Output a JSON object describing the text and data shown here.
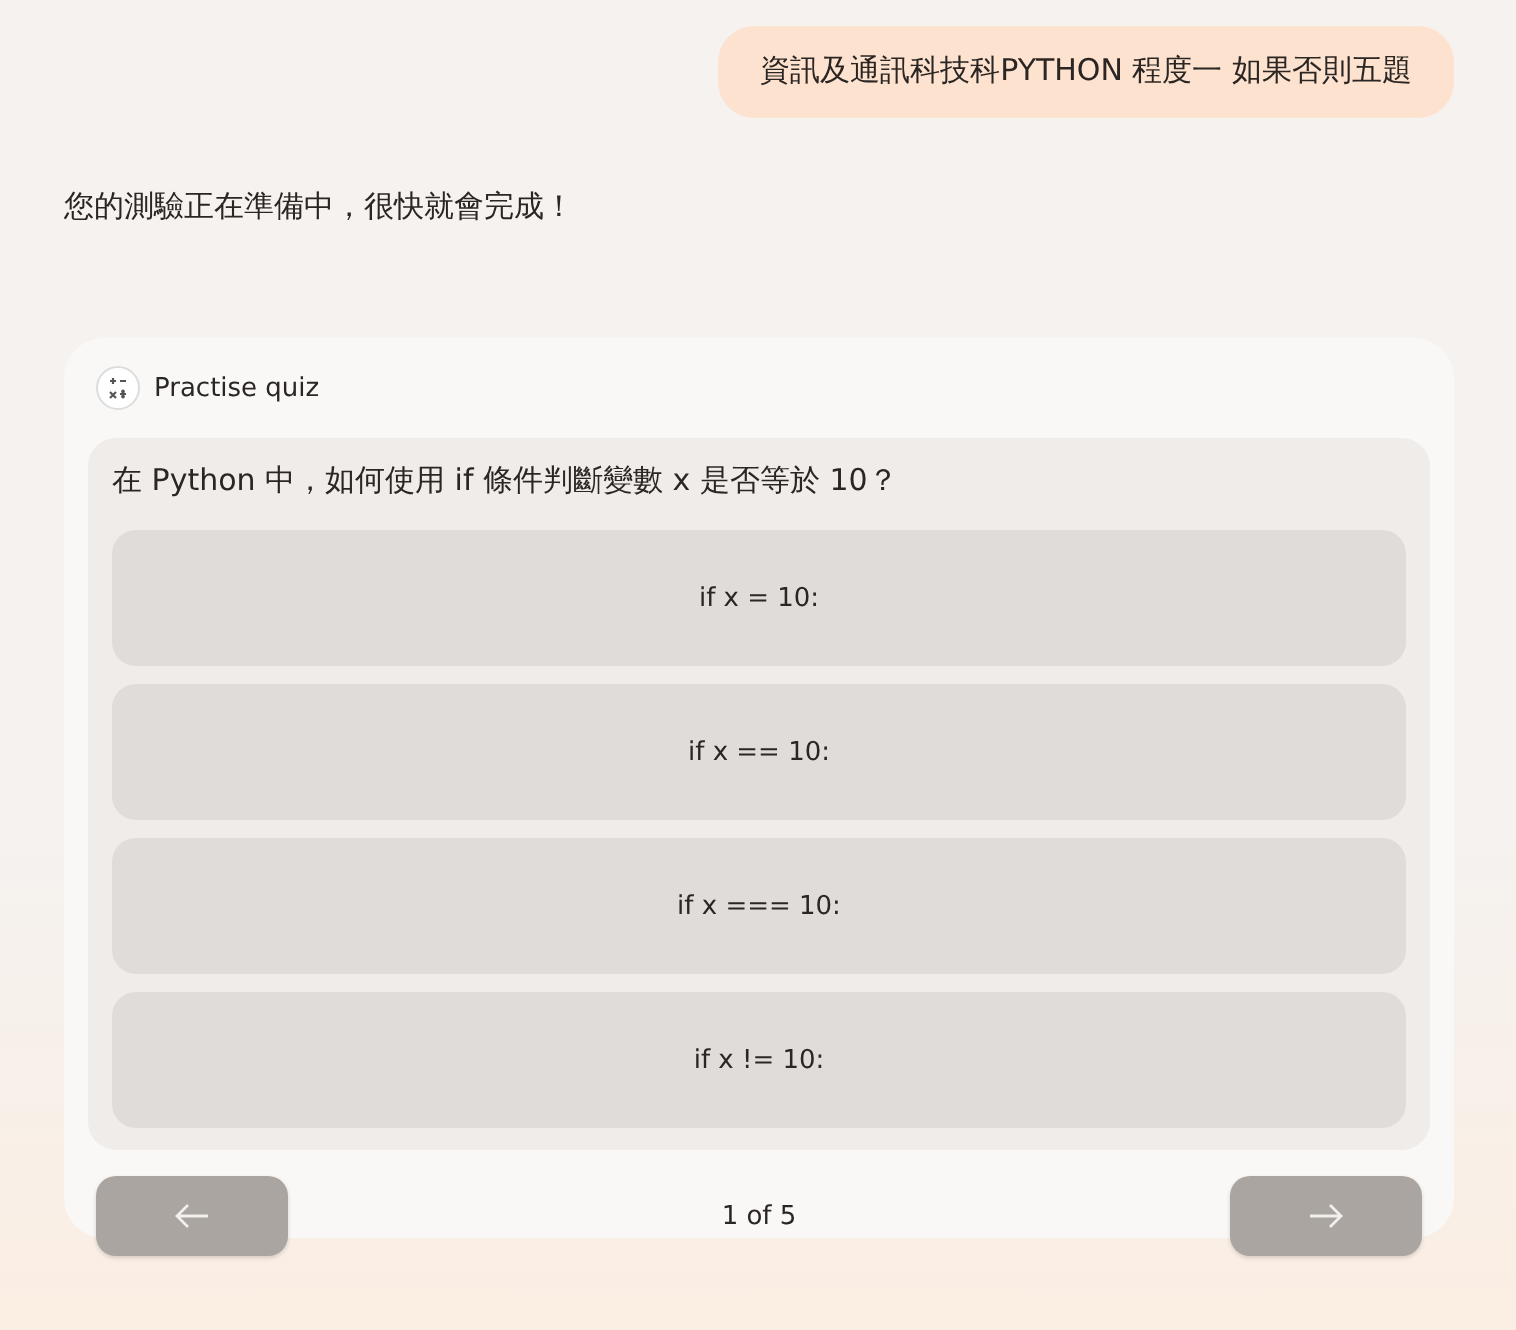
{
  "user_message": "資訊及通訊科技科PYTHON 程度一 如果否則五題",
  "assistant_message": "您的測驗正在準備中，很快就會完成！",
  "quiz": {
    "title": "Practise quiz",
    "question": "在 Python 中，如何使用 if 條件判斷變數 x 是否等於 10？",
    "options": [
      {
        "label": "if x = 10:",
        "selected": false
      },
      {
        "label": "if x == 10:",
        "selected": false
      },
      {
        "label": "if x === 10:",
        "selected": false
      },
      {
        "label": "if x != 10:",
        "selected": false
      }
    ],
    "progress": "1 of 5"
  }
}
